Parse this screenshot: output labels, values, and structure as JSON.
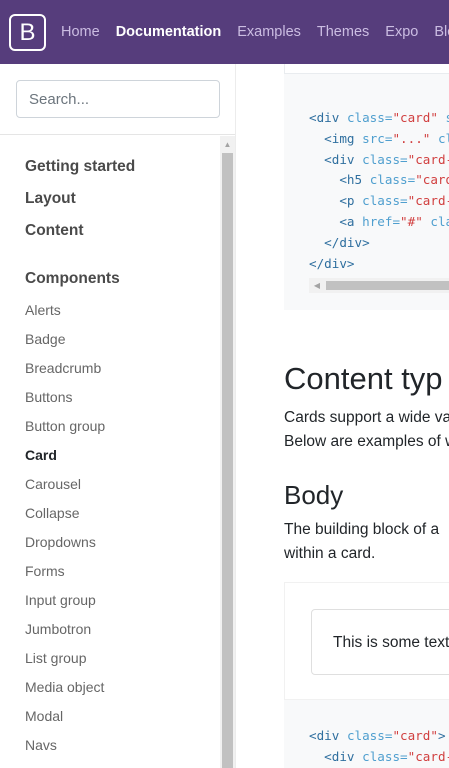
{
  "navbar": {
    "brand": "B",
    "links": [
      "Home",
      "Documentation",
      "Examples",
      "Themes",
      "Expo",
      "Blog"
    ],
    "active_index": 1
  },
  "sidebar": {
    "search_placeholder": "Search...",
    "sections": [
      "Getting started",
      "Layout",
      "Content",
      "Components"
    ],
    "items": [
      "Alerts",
      "Badge",
      "Breadcrumb",
      "Buttons",
      "Button group",
      "Card",
      "Carousel",
      "Collapse",
      "Dropdowns",
      "Forms",
      "Input group",
      "Jumbotron",
      "List group",
      "Media object",
      "Modal",
      "Navs"
    ],
    "active_item": "Card"
  },
  "main": {
    "code1": {
      "l1": {
        "tag": "<div",
        "attr": "class=",
        "val": "\"card\"",
        "rest": " s"
      },
      "l2": {
        "tag": "<img",
        "attr": "src=",
        "val": "\"...\"",
        "rest": " cl"
      },
      "l3": {
        "tag": "<div",
        "attr": "class=",
        "val": "\"card-"
      },
      "l4": {
        "tag": "<h5",
        "attr": "class=",
        "val": "\"card"
      },
      "l5": {
        "tag": "<p",
        "attr": "class=",
        "val": "\"card-"
      },
      "l6": {
        "tag": "<a",
        "attr": "href=",
        "val": "\"#\"",
        "rest": " cla"
      },
      "l7": {
        "tag": "</div>"
      },
      "l8": {
        "tag": "</div>"
      }
    },
    "heading_content_types": "Content typ",
    "content_types_text": [
      "Cards support a wide va",
      "Below are examples of w"
    ],
    "heading_body": "Body",
    "body_text": [
      "The building block of a",
      "within a card."
    ],
    "card_text": "This is some text",
    "code2": {
      "l1": {
        "tag": "<div",
        "attr": "class=",
        "val": "\"card\"",
        "rest": ">"
      },
      "l2": {
        "tag": "<div",
        "attr": "class=",
        "val": "\"card-"
      }
    }
  },
  "colors": {
    "navbar_bg": "#563d7c",
    "code_bg": "#f8f9fa",
    "code_tag": "#2f6f9f",
    "code_string": "#d14040"
  }
}
